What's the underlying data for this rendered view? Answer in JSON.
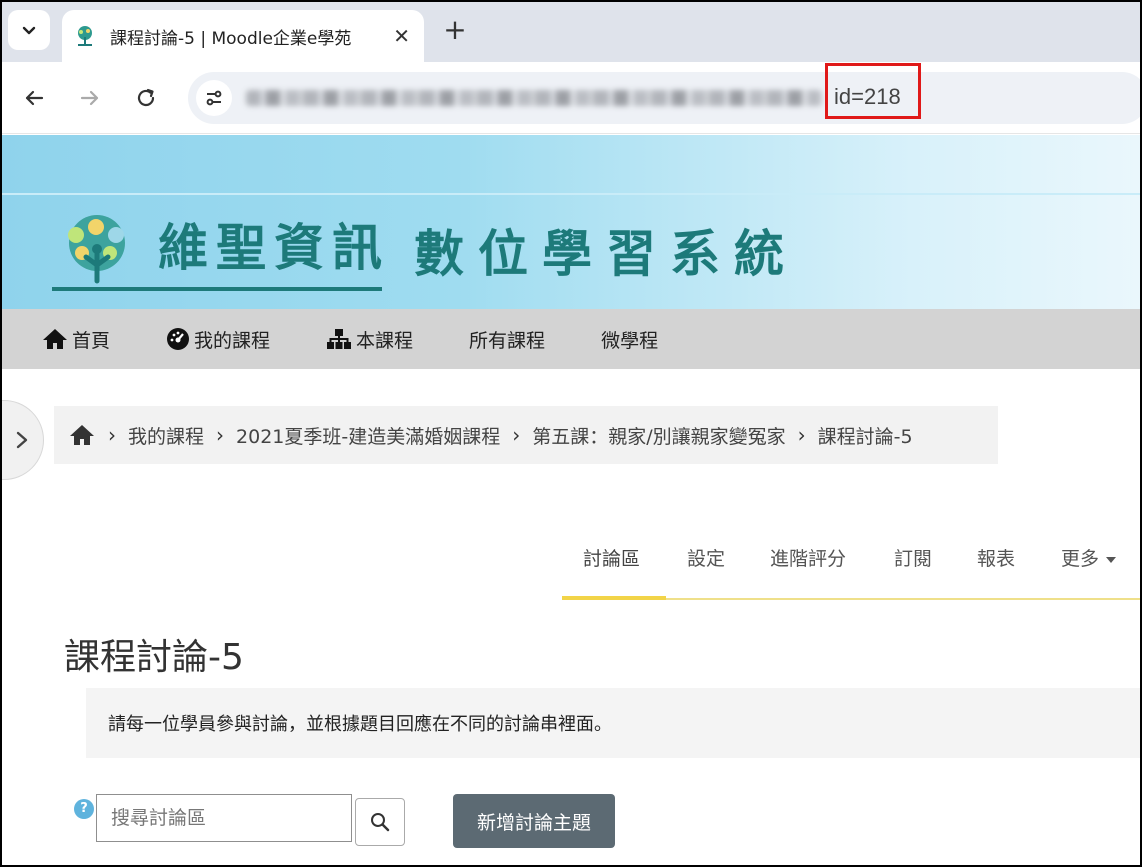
{
  "browser": {
    "tab_title": "課程討論-5 | Moodle企業e學苑",
    "close_glyph": "✕",
    "new_tab_glyph": "+",
    "url_visible": "id=218"
  },
  "brand": {
    "name": "維聖資訊",
    "tagline": "數位學習系統"
  },
  "primary_nav": [
    {
      "label": "首頁",
      "icon": "home-icon"
    },
    {
      "label": "我的課程",
      "icon": "dashboard-icon"
    },
    {
      "label": "本課程",
      "icon": "sitemap-icon"
    },
    {
      "label": "所有課程",
      "icon": ""
    },
    {
      "label": "微學程",
      "icon": ""
    }
  ],
  "breadcrumb": [
    "我的課程",
    "2021夏季班-建造美滿婚姻課程",
    "第五課：親家/別讓親家變冤家",
    "課程討論-5"
  ],
  "secondary_nav": {
    "tabs": [
      "討論區",
      "設定",
      "進階評分",
      "訂閱",
      "報表",
      "更多"
    ],
    "active": "討論區"
  },
  "page": {
    "title": "課程討論-5",
    "intro": "請每一位學員參與討論，並根據題目回應在不同的討論串裡面。"
  },
  "search": {
    "help_glyph": "?",
    "placeholder": "搜尋討論區"
  },
  "actions": {
    "add_discussion": "新增討論主題"
  },
  "colors": {
    "brand_teal": "#1d7a7a",
    "nav_bg": "#d3d3d3",
    "active_tab_bar": "#f2d448",
    "primary_button": "#5c6a73",
    "highlight_box": "#e01919"
  }
}
